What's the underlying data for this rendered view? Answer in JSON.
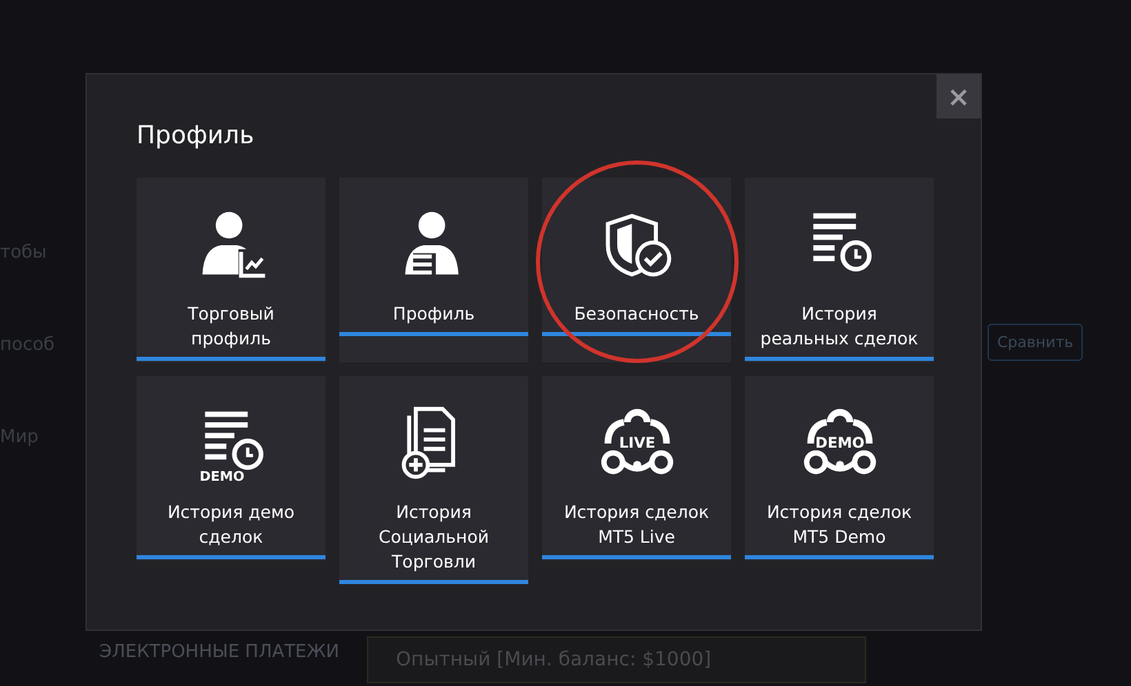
{
  "background": {
    "left_texts": [
      "тобы",
      "пособ",
      "Мир"
    ],
    "compare_button": "Сравнить",
    "section_title": "ЭЛЕКТРОННЫЕ ПЛАТЕЖИ",
    "level_option": "Опытный [Мин. баланс: $1000]"
  },
  "modal": {
    "title": "Профиль",
    "close": "×",
    "tiles": [
      {
        "label": "Торговый профиль",
        "kind": "person-chart",
        "highlighted": false
      },
      {
        "label": "Профиль",
        "kind": "person-list",
        "highlighted": false
      },
      {
        "label": "Безопасность",
        "kind": "shield-check",
        "highlighted": true
      },
      {
        "label": "История реальных сделок",
        "kind": "list-history",
        "highlighted": false
      },
      {
        "label": "История демо сделок",
        "kind": "list-history",
        "badge": "DEMO",
        "highlighted": false
      },
      {
        "label": "История Социальной Торговли",
        "kind": "document-add",
        "highlighted": false
      },
      {
        "label": "История сделок MT5 Live",
        "kind": "network",
        "badge": "LIVE",
        "highlighted": false
      },
      {
        "label": "История сделок MT5 Demo",
        "kind": "network",
        "badge": "DEMO",
        "highlighted": false
      }
    ]
  }
}
